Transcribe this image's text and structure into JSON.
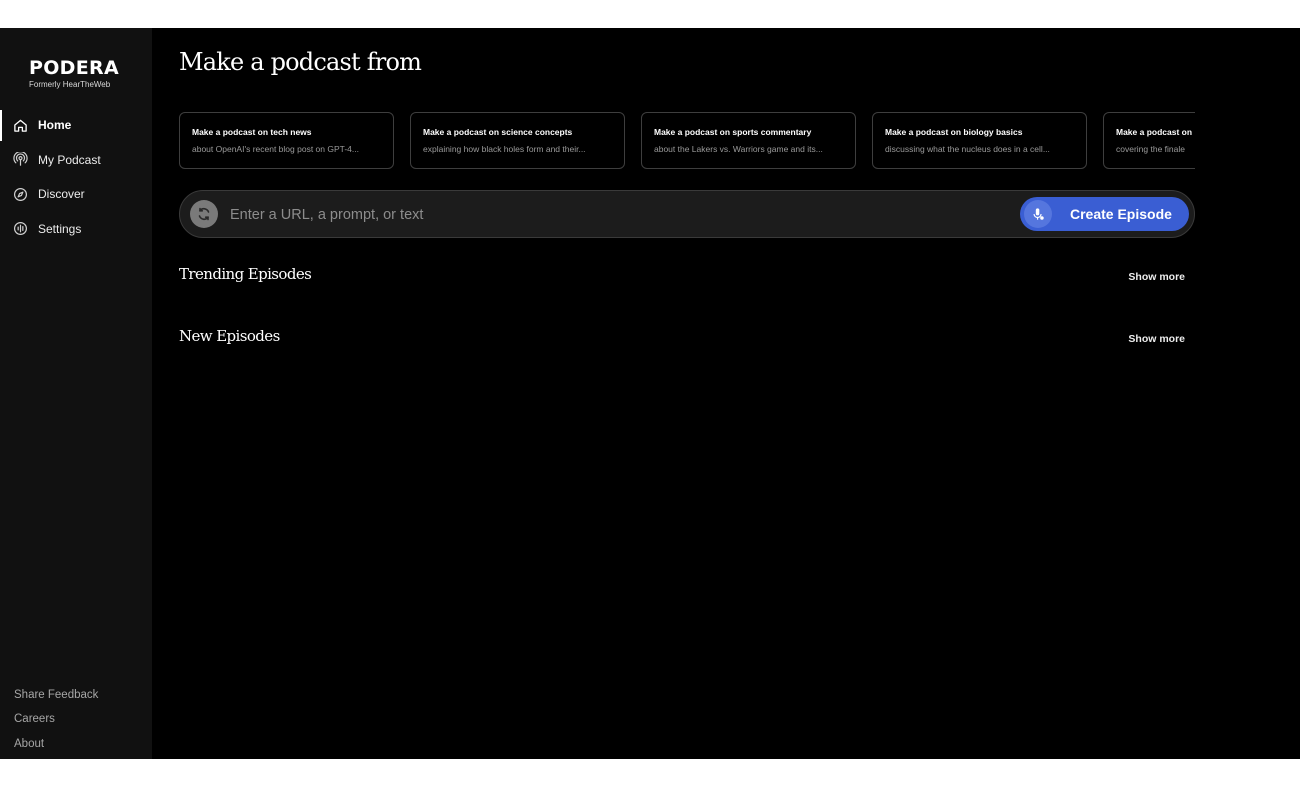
{
  "brand": {
    "name": "PODERA",
    "tagline": "Formerly HearTheWeb"
  },
  "nav": {
    "items": [
      {
        "label": "Home",
        "icon": "home-icon"
      },
      {
        "label": "My Podcast",
        "icon": "podcast-icon"
      },
      {
        "label": "Discover",
        "icon": "compass-icon"
      },
      {
        "label": "Settings",
        "icon": "settings-icon"
      }
    ],
    "active": "Home"
  },
  "footer_links": [
    "Share Feedback",
    "Careers",
    "About"
  ],
  "heading": "Make a podcast from",
  "suggestions": [
    {
      "title": "Make a podcast on tech news",
      "subtitle": "about OpenAI's recent blog post on GPT-4..."
    },
    {
      "title": "Make a podcast on science concepts",
      "subtitle": "explaining how black holes form and their..."
    },
    {
      "title": "Make a podcast on sports commentary",
      "subtitle": "about the Lakers vs. Warriors game and its..."
    },
    {
      "title": "Make a podcast on biology basics",
      "subtitle": "discussing what the nucleus does in a cell..."
    },
    {
      "title": "Make a podcast on",
      "subtitle": "covering the finale"
    }
  ],
  "input": {
    "placeholder": "Enter a URL, a prompt, or text",
    "value": ""
  },
  "create_button": {
    "label": "Create Episode",
    "icon": "microphone-icon"
  },
  "sections": {
    "trending": {
      "title": "Trending Episodes",
      "show_more": "Show more"
    },
    "new": {
      "title": "New Episodes",
      "show_more": "Show more"
    }
  },
  "colors": {
    "accent": "#3a5ed3",
    "sidebar_bg": "#111111",
    "main_bg": "#000000"
  }
}
